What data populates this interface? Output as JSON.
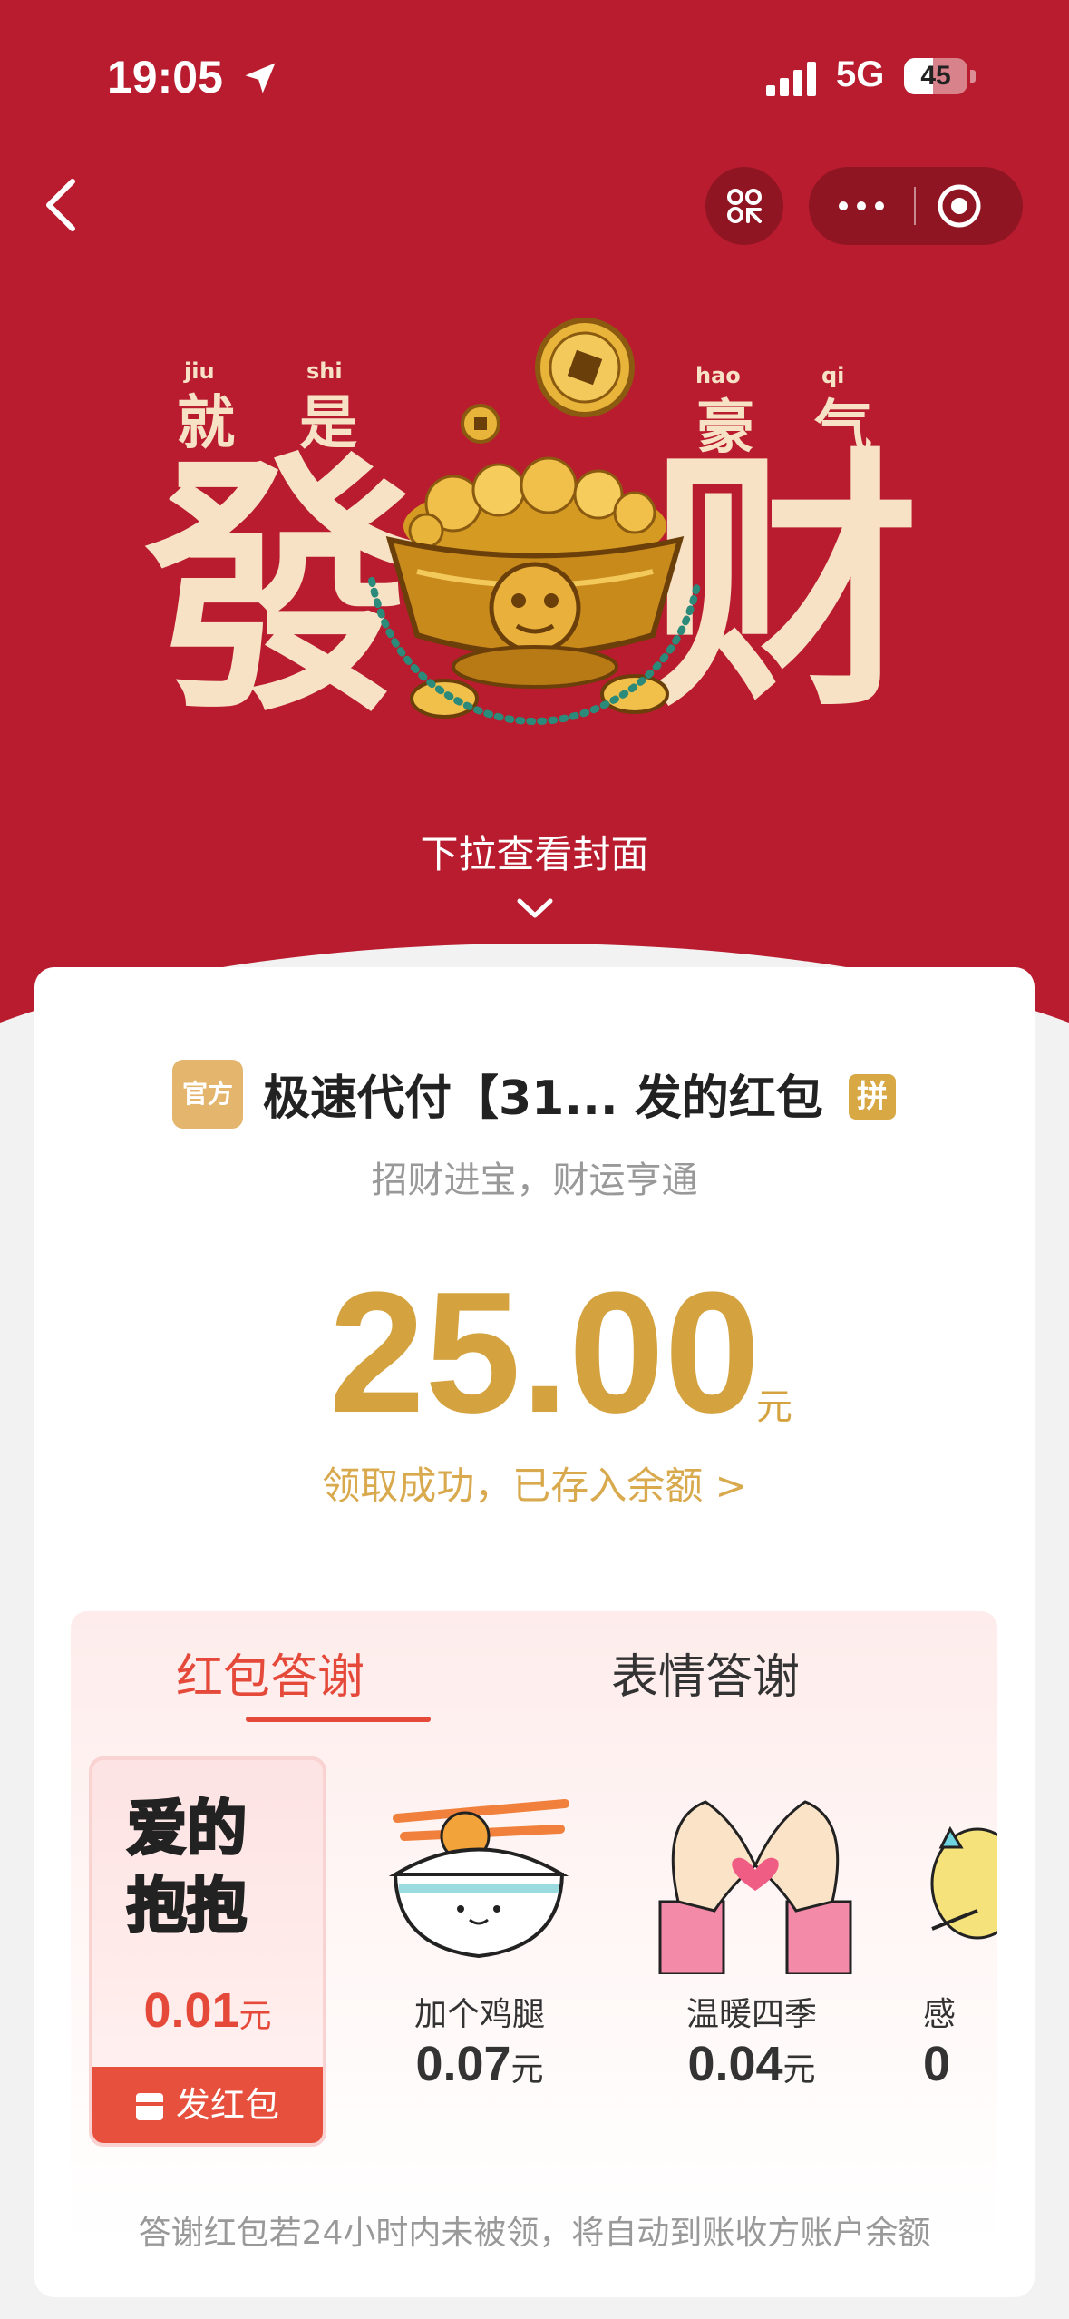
{
  "status_bar": {
    "time": "19:05",
    "network": "5G",
    "battery": "45",
    "battery_level_percent": 45
  },
  "cover": {
    "small_left": [
      "就",
      "是"
    ],
    "pinyin_left": [
      "jiu",
      "shi"
    ],
    "small_right": [
      "豪",
      "气"
    ],
    "pinyin_right": [
      "hao",
      "qi"
    ],
    "big_left": "發",
    "big_right": "财",
    "pull_hint": "下拉查看封面"
  },
  "envelope": {
    "official_badge": "官方",
    "sender": "极速代付【31... 发的红包",
    "pin_badge": "拼",
    "blessing": "招财进宝，财运亨通",
    "amount": "25.00",
    "amount_unit": "元",
    "status_text": "领取成功，已存入余额 >"
  },
  "thanks": {
    "tabs": [
      "红包答谢",
      "表情答谢"
    ],
    "gifts": [
      {
        "name": "爱的抱抱",
        "price": "0.01",
        "unit": "元",
        "action": "发红包"
      },
      {
        "name": "加个鸡腿",
        "price": "0.07",
        "unit": "元"
      },
      {
        "name": "温暖四季",
        "price": "0.04",
        "unit": "元"
      },
      {
        "name": "感",
        "price": "0",
        "unit": ""
      }
    ],
    "footnote": "答谢红包若24小时内未被领，将自动到账收方账户余额"
  },
  "colors": {
    "header_red": "#b91c2e",
    "gold": "#d4a33f",
    "accent_red": "#e5493a"
  }
}
